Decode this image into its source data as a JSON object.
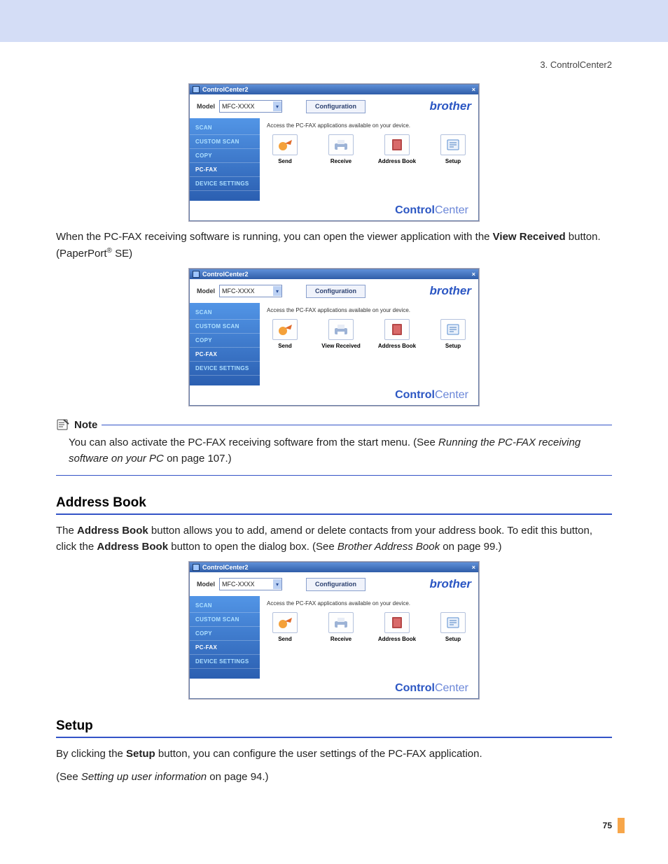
{
  "header": {
    "breadcrumb": "3. ControlCenter2"
  },
  "page_number": "75",
  "para1": {
    "pre": "When the PC-FAX receiving software is running, you can open the viewer application with the ",
    "button_name": "View Received",
    "mid": " button. (PaperPort",
    "reg": "®",
    "post": " SE)"
  },
  "note": {
    "title": "Note",
    "body_pre": "You can also activate the PC-FAX receiving software from the start menu. (See ",
    "body_link": "Running the PC-FAX receiving software on your PC",
    "body_post": " on page 107.)"
  },
  "section_address": {
    "title": "Address Book"
  },
  "para_address": {
    "t1": "The ",
    "b1": "Address Book",
    "t2": " button allows you to add, amend or delete contacts from your address book. To edit this button, click the ",
    "b2": "Address Book",
    "t3": " button to open the dialog box. (See ",
    "i1": "Brother Address Book",
    "t4": " on page 99.)"
  },
  "section_setup": {
    "title": "Setup"
  },
  "para_setup1": {
    "t1": "By clicking the ",
    "b1": "Setup",
    "t2": " button, you can configure the user settings of the PC-FAX application."
  },
  "para_setup2": {
    "t1": "(See ",
    "i1": "Setting up user information",
    "t2": " on page 94.)"
  },
  "cc": {
    "title": "ControlCenter2",
    "model_label": "Model",
    "model_value": "MFC-XXXX",
    "config": "Configuration",
    "brand": "brother",
    "sidebar": [
      "SCAN",
      "CUSTOM SCAN",
      "COPY",
      "PC-FAX",
      "DEVICE SETTINGS"
    ],
    "active_index": 3,
    "desc": "Access the PC-FAX applications available on your device.",
    "footer_bold": "Control",
    "footer_light": " Center",
    "buttons_receive": [
      "Send",
      "Receive",
      "Address Book",
      "Setup"
    ],
    "buttons_view": [
      "Send",
      "View Received",
      "Address Book",
      "Setup"
    ]
  }
}
